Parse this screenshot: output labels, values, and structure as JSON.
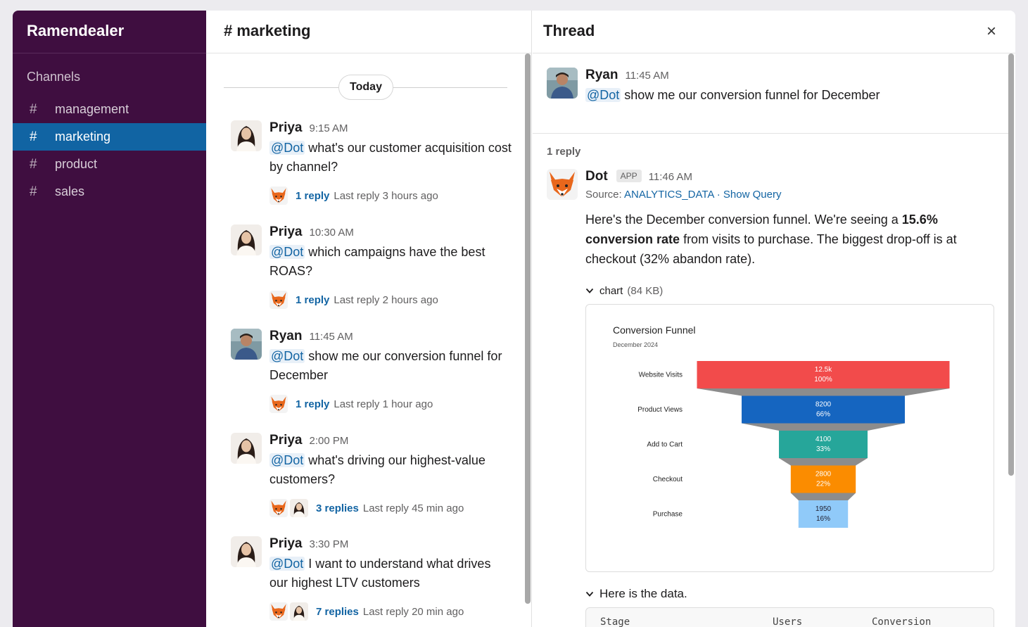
{
  "workspace": {
    "name": "Ramendealer"
  },
  "sidebar": {
    "section_title": "Channels",
    "channels": [
      {
        "name": "management",
        "active": false
      },
      {
        "name": "marketing",
        "active": true
      },
      {
        "name": "product",
        "active": false
      },
      {
        "name": "sales",
        "active": false
      }
    ],
    "hash": "#"
  },
  "channel": {
    "title": "# marketing",
    "day_divider": "Today",
    "messages": [
      {
        "author": "Priya",
        "time": "9:15 AM",
        "mention": "@Dot",
        "text": " what's our customer acquisition cost by channel?",
        "reply_count": "1 reply",
        "last_reply": "Last reply 3 hours ago",
        "reply_avatars": [
          "fox"
        ]
      },
      {
        "author": "Priya",
        "time": "10:30 AM",
        "mention": "@Dot",
        "text": " which campaigns have the best ROAS?",
        "reply_count": "1 reply",
        "last_reply": "Last reply 2 hours ago",
        "reply_avatars": [
          "fox"
        ]
      },
      {
        "author": "Ryan",
        "time": "11:45 AM",
        "mention": "@Dot",
        "text": " show me our conversion funnel for December",
        "reply_count": "1 reply",
        "last_reply": "Last reply 1 hour ago",
        "reply_avatars": [
          "fox"
        ]
      },
      {
        "author": "Priya",
        "time": "2:00 PM",
        "mention": "@Dot",
        "text": " what's driving our highest-value customers?",
        "reply_count": "3 replies",
        "last_reply": "Last reply 45 min ago",
        "reply_avatars": [
          "fox",
          "woman"
        ]
      },
      {
        "author": "Priya",
        "time": "3:30 PM",
        "mention": "@Dot",
        "text": " I want to understand what drives our highest LTV customers",
        "reply_count": "7 replies",
        "last_reply": "Last reply 20 min ago",
        "reply_avatars": [
          "fox",
          "woman"
        ]
      }
    ]
  },
  "thread": {
    "title": "Thread",
    "close_glyph": "×",
    "parent": {
      "author": "Ryan",
      "time": "11:45 AM",
      "mention": "@Dot",
      "text": " show me our conversion funnel for December"
    },
    "reply_label": "1 reply",
    "bot": {
      "author": "Dot",
      "badge": "APP",
      "time": "11:46 AM",
      "source_label": "Source: ",
      "source_value": "ANALYTICS_DATA",
      "show_query": "· Show Query",
      "text_1": "Here's the December conversion funnel. We're seeing a ",
      "text_bold": "15.6% conversion rate",
      "text_2": " from visits to purchase. The biggest drop-off is at checkout (32% abandon rate).",
      "attachment_name": "chart",
      "attachment_size": "(84 KB)",
      "data_label": "Here is the data.",
      "table_headers": [
        "Stage",
        "Users",
        "Conversion"
      ]
    }
  },
  "colors": {
    "sidebar": "#3f0e40",
    "active_channel": "#1164a3",
    "link": "#1264a3"
  },
  "chart_data": {
    "type": "funnel",
    "title": "Conversion Funnel",
    "subtitle": "December 2024",
    "stages": [
      {
        "name": "Website Visits",
        "value": 12500,
        "value_label": "12.5k",
        "pct_label": "100%",
        "color": "#f24b4b"
      },
      {
        "name": "Product Views",
        "value": 8200,
        "value_label": "8200",
        "pct_label": "66%",
        "color": "#1565c0"
      },
      {
        "name": "Add to Cart",
        "value": 4100,
        "value_label": "4100",
        "pct_label": "33%",
        "color": "#26a69a"
      },
      {
        "name": "Checkout",
        "value": 2800,
        "value_label": "2800",
        "pct_label": "22%",
        "color": "#fb8c00"
      },
      {
        "name": "Purchase",
        "value": 1950,
        "value_label": "1950",
        "pct_label": "16%",
        "color": "#90caf9"
      }
    ]
  }
}
